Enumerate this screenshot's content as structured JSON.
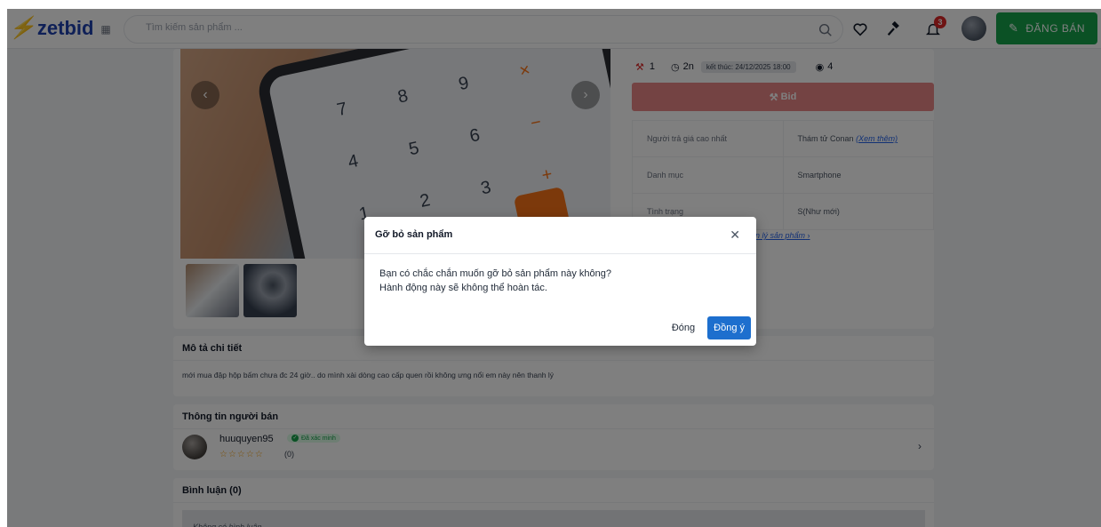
{
  "header": {
    "logo_text": "zetbid",
    "search_placeholder": "Tìm kiếm sản phẩm ...",
    "notification_count": "3",
    "sell_label": "ĐĂNG BÁN"
  },
  "product": {
    "bids": "1",
    "time_left": "2n",
    "end_time": "kết thúc: 24/12/2025 18:00",
    "views": "4",
    "bid_button": "Bid",
    "info_rows": [
      {
        "label": "Người trả giá cao nhất",
        "value": "Thám tử Conan",
        "link": "(Xem thêm)"
      },
      {
        "label": "Danh mục",
        "value": "Smartphone"
      },
      {
        "label": "Tình trạng",
        "value": "S(Như mới)"
      }
    ],
    "manage_link": "n lý sản phẩm"
  },
  "description": {
    "title": "Mô tả chi tiết",
    "text": "mới mua đập hộp bấm chưa đc 24 giờ.. do mình xài dòng cao cấp quen rồi không ưng nổi em này nên thanh lý"
  },
  "seller": {
    "title": "Thông tin người bán",
    "name": "huuquyen95",
    "verified_label": "Đã xác minh",
    "stars": "☆☆☆☆☆",
    "rating_count": "(0)"
  },
  "comments": {
    "title": "Bình luận (0)",
    "empty_text": "Không có bình luận"
  },
  "modal": {
    "title": "Gỡ bỏ sản phẩm",
    "line1": "Bạn có chắc chắn muốn gỡ bỏ sản phẩm này không?",
    "line2": "Hành động này sẽ không thể hoàn tác.",
    "cancel_label": "Đóng",
    "confirm_label": "Đồng ý"
  },
  "colors": {
    "brand_blue": "#1e40af",
    "sell_green": "#16a34a",
    "bid_red": "#e98787",
    "confirm_blue": "#1d6fce"
  }
}
